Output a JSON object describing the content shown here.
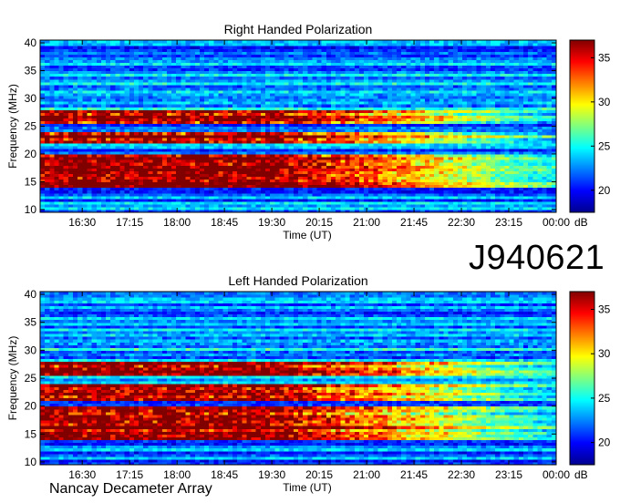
{
  "id_label": "J940621",
  "footer": "Nancay Decameter Array",
  "colorbar_unit": "dB",
  "chart_data": [
    {
      "type": "heatmap",
      "title": "Right Handed Polarization",
      "xlabel": "Time (UT)",
      "ylabel": "Frequency (MHz)",
      "xticks": [
        "16:30",
        "17:15",
        "18:00",
        "18:45",
        "19:30",
        "20:15",
        "21:00",
        "21:45",
        "22:30",
        "23:15",
        "00:00"
      ],
      "yticks": [
        10,
        15,
        20,
        25,
        30,
        35,
        40
      ],
      "xlim": [
        "15:50",
        "00:00"
      ],
      "ylim": [
        9.5,
        40.5
      ],
      "colorbar": {
        "unit": "dB",
        "ticks": [
          20,
          25,
          30,
          35
        ],
        "range": [
          17.5,
          37
        ]
      },
      "emission_bands_mhz": [
        [
          14,
          20
        ],
        [
          22,
          24
        ],
        [
          25.5,
          28
        ]
      ]
    },
    {
      "type": "heatmap",
      "title": "Left Handed Polarization",
      "xlabel": "Time (UT)",
      "ylabel": "Frequency (MHz)",
      "xticks": [
        "16:30",
        "17:15",
        "18:00",
        "18:45",
        "19:30",
        "20:15",
        "21:00",
        "21:45",
        "22:30",
        "23:15",
        "00:00"
      ],
      "yticks": [
        10,
        15,
        20,
        25,
        30,
        35,
        40
      ],
      "xlim": [
        "15:50",
        "00:00"
      ],
      "ylim": [
        9.5,
        40.5
      ],
      "colorbar": {
        "unit": "dB",
        "ticks": [
          20,
          25,
          30,
          35
        ],
        "range": [
          17.5,
          37
        ]
      },
      "emission_bands_mhz": [
        [
          14,
          20
        ],
        [
          21,
          24
        ],
        [
          25.5,
          28
        ]
      ]
    }
  ]
}
